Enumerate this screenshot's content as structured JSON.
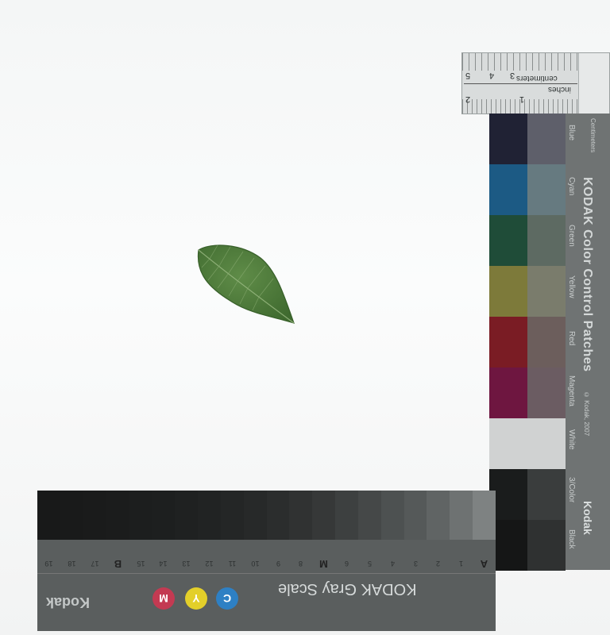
{
  "ruler": {
    "numbers": [
      "2",
      "1",
      "4",
      "3",
      "5"
    ],
    "unit_top": "inches",
    "unit_bottom": "centimeters"
  },
  "color_chart": {
    "title": "KODAK Color Control Patches",
    "brand": "Kodak",
    "side_top_label": "Centimeters",
    "small_print": "© Kodak, 2007",
    "patch_names": [
      "Blue",
      "Cyan",
      "Green",
      "Yellow",
      "Red",
      "Magenta",
      "White",
      "3/Color",
      "Black"
    ],
    "colors": {
      "blue": "#202234",
      "cyan": "#1c5a84",
      "green": "#1f4c38",
      "yellow": "#7d7a3a",
      "red": "#7a1c24",
      "magenta": "#6e1640",
      "white": "#d0d2d2",
      "three_color": "#1a1c1c",
      "black": "#151616"
    }
  },
  "gray_scale": {
    "title": "KODAK Gray Scale",
    "brand": "Kodak",
    "labels": [
      "A",
      "1",
      "2",
      "3",
      "4",
      "5",
      "6",
      "M",
      "8",
      "9",
      "10",
      "11",
      "12",
      "13",
      "14",
      "15",
      "B",
      "17",
      "18",
      "19"
    ],
    "cmy": [
      "C",
      "Y",
      "M"
    ],
    "cmy_colors": [
      "#2e80c4",
      "#e3cf2a",
      "#c33a52"
    ],
    "patch_colors": [
      "#7e8282",
      "#6e7272",
      "#606464",
      "#555959",
      "#4d5151",
      "#454848",
      "#3d4040",
      "#363838",
      "#303232",
      "#2b2d2d",
      "#272929",
      "#242626",
      "#212323",
      "#1f2121",
      "#1d1f1f",
      "#1c1e1e",
      "#1b1c1c",
      "#1a1b1b",
      "#191a1a",
      "#181919"
    ]
  },
  "leaf": {
    "fill": "#4f7a3a",
    "vein": "#8fb07a"
  }
}
